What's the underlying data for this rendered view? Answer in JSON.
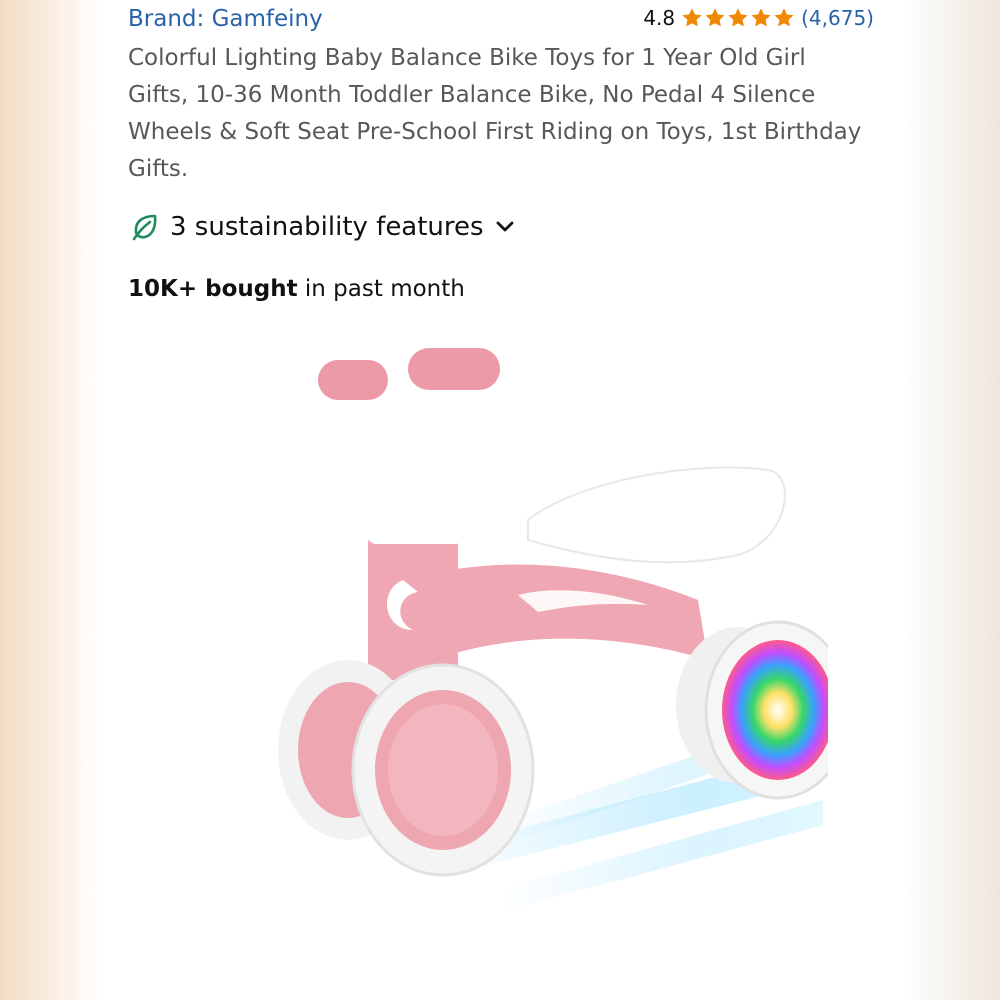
{
  "brand": {
    "label": "Brand: Gamfeiny"
  },
  "rating": {
    "value": "4.8",
    "stars": 4.8,
    "count": "(4,675)",
    "star_color": "#f08804"
  },
  "product": {
    "title": "Colorful Lighting Baby Balance Bike Toys for 1 Year Old Girl Gifts, 10-36 Month Toddler Balance Bike, No Pedal 4 Silence Wheels & Soft Seat Pre-School First Riding on Toys, 1st Birthday Gifts."
  },
  "sustainability": {
    "label": "3 sustainability features",
    "icon": "leaf-icon",
    "icon_color": "#1f8a5b"
  },
  "purchases": {
    "bold": "10K+ bought",
    "rest": " in past month"
  },
  "image": {
    "subject": "pink toddler balance bike with light-up wheels"
  },
  "colors": {
    "link": "#2a62a8",
    "title_text": "#565959",
    "bike_pink": "#eea6b0"
  }
}
